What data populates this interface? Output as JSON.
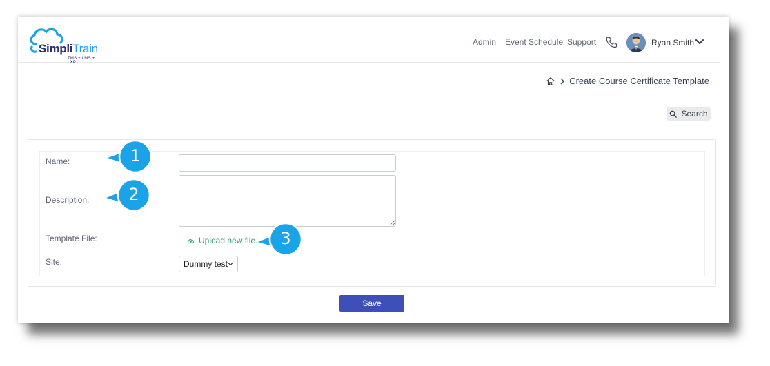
{
  "app": {
    "logo_main": "Simpli",
    "logo_accent": "Train",
    "logo_sub": "TMS + LMS + LXP"
  },
  "nav": {
    "admin": "Admin",
    "event_schedule": "Event Schedule",
    "support": "Support",
    "user_name": "Ryan Smith"
  },
  "breadcrumb": {
    "current": "Create Course Certificate Template"
  },
  "toolbar": {
    "search_label": "Search"
  },
  "form": {
    "name_label": "Name:",
    "name_value": "",
    "description_label": "Description:",
    "description_value": "",
    "template_label": "Template File:",
    "upload_label": "Upload new file...",
    "site_label": "Site:",
    "site_value": "Dummy test",
    "save_label": "Save"
  },
  "callouts": {
    "one": "1",
    "two": "2",
    "three": "3"
  },
  "colors": {
    "brand_dark": "#2a2f6e",
    "brand_light": "#1fa2e0",
    "primary_button": "#3f4fb8",
    "upload_link": "#2ea36a",
    "callout": "#1aa3e6"
  },
  "icons": {
    "phone": "phone-icon",
    "home": "home-icon",
    "search": "search-icon",
    "upload": "cloud-upload-icon",
    "chevron": "chevron-down-icon"
  }
}
